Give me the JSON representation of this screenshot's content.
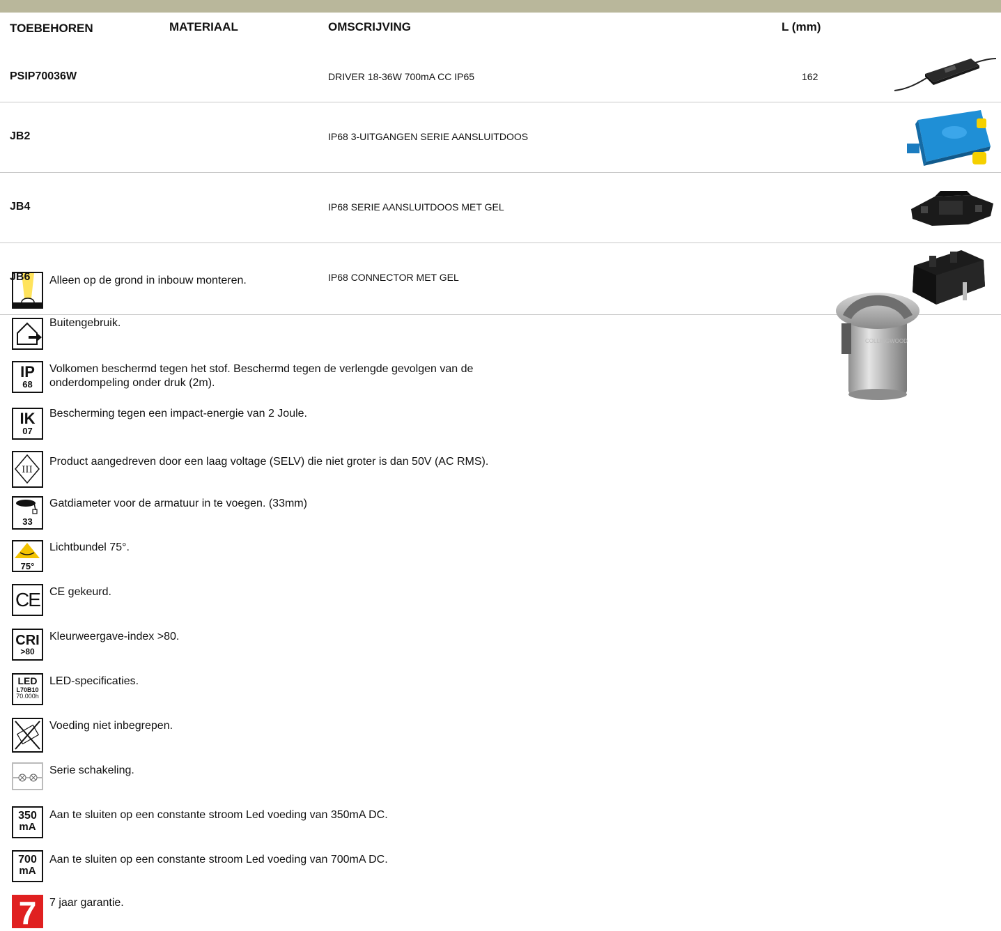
{
  "header": {
    "col_accessory": "TOEBEHOREN",
    "col_material": "MATERIAAL",
    "col_description": "OMSCRIJVING",
    "col_length": "L (mm)"
  },
  "accessories": [
    {
      "code": "PSIP70036W",
      "description": "DRIVER 18-36W 700mA CC IP65",
      "length": "162",
      "image": "driver-photo"
    },
    {
      "code": "JB2",
      "description": "IP68 3-UITGANGEN SERIE AANSLUITDOOS",
      "length": "",
      "image": "blue-junction-box-photo"
    },
    {
      "code": "JB4",
      "description": "IP68 SERIE AANSLUITDOOS MET GEL",
      "length": "",
      "image": "black-junction-box-photo"
    },
    {
      "code": "JB6",
      "description": "IP68 CONNECTOR MET GEL",
      "length": "",
      "image": "black-connector-photo"
    }
  ],
  "legend": [
    {
      "icon": "ground-recessed-icon",
      "text": "Alleen op de grond in inbouw monteren."
    },
    {
      "icon": "outdoor-use-icon",
      "text": "Buitengebruik."
    },
    {
      "icon": "ip68-icon",
      "icon_label_top": "IP",
      "icon_label_bottom": "68",
      "text": "Volkomen beschermd tegen het stof. Beschermd tegen de verlengde gevolgen van de onderdompeling onder druk (2m)."
    },
    {
      "icon": "ik07-icon",
      "icon_label_top": "IK",
      "icon_label_bottom": "07",
      "text": "Bescherming tegen een impact-energie van 2 Joule."
    },
    {
      "icon": "selv-class-iii-icon",
      "icon_label_top": "III",
      "text": "Product aangedreven door een laag voltage (SELV) die niet groter is dan 50V (AC RMS)."
    },
    {
      "icon": "hole-diameter-icon",
      "icon_label_bottom": "33",
      "text": "Gatdiameter voor de armatuur in te voegen. (33mm)"
    },
    {
      "icon": "beam-angle-icon",
      "icon_label_bottom": "75°",
      "text": "Lichtbundel 75°."
    },
    {
      "icon": "ce-mark-icon",
      "icon_label_top": "CE",
      "text": "CE gekeurd."
    },
    {
      "icon": "cri-icon",
      "icon_label_top": "CRI",
      "icon_label_bottom": ">80",
      "text": "Kleurweergave-index >80."
    },
    {
      "icon": "led-spec-icon",
      "icon_label_top": "LED",
      "icon_label_mid": "L70B10",
      "icon_label_bottom": "70.000h",
      "text": "LED-specificaties."
    },
    {
      "icon": "no-driver-icon",
      "text": "Voeding niet inbegrepen."
    },
    {
      "icon": "series-connection-icon",
      "text": "Serie schakeling."
    },
    {
      "icon": "350ma-icon",
      "icon_label_top": "350",
      "icon_label_bottom": "mA",
      "text": "Aan te sluiten op een constante stroom Led voeding van 350mA DC."
    },
    {
      "icon": "700ma-icon",
      "icon_label_top": "700",
      "icon_label_bottom": "mA",
      "text": "Aan te sluiten op een constante stroom Led voeding van 700mA DC."
    },
    {
      "icon": "warranty-7-icon",
      "icon_label_top": "7",
      "text": "7 jaar garantie."
    }
  ],
  "colors": {
    "top_bar": "#b9b79b",
    "separator": "#c8c8c8",
    "warranty_red": "#e02020",
    "beam_yellow": "#f3c300"
  }
}
